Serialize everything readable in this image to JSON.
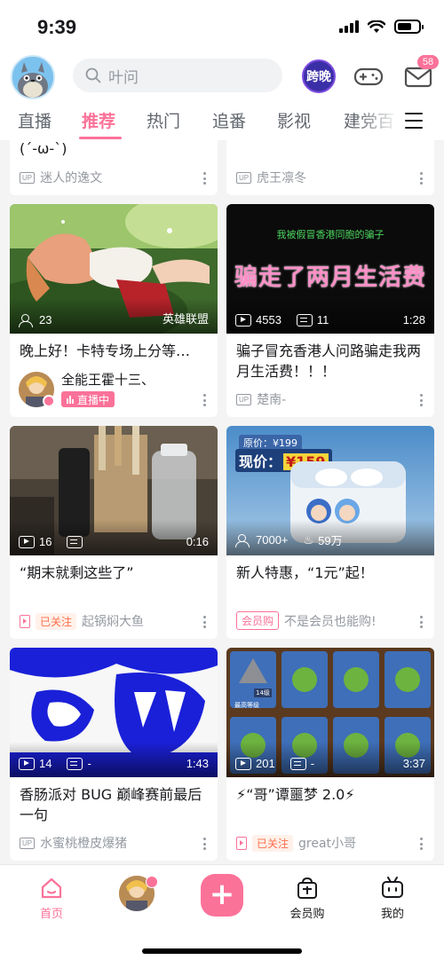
{
  "status_bar": {
    "time": "9:39"
  },
  "header": {
    "search_placeholder": "叶问",
    "event_label": "跨晚",
    "mail_badge": "58"
  },
  "tabs": [
    {
      "label": "直播",
      "active": false
    },
    {
      "label": "推荐",
      "active": true
    },
    {
      "label": "热门",
      "active": false
    },
    {
      "label": "追番",
      "active": false
    },
    {
      "label": "影视",
      "active": false
    },
    {
      "label": "建党百",
      "active": false
    }
  ],
  "feed": {
    "partial_top": [
      {
        "title": "(´-ω-`)",
        "author": "迷人的逸文",
        "tag": "UP"
      },
      {
        "title": "",
        "author": "虎王凛冬",
        "tag": "UP"
      }
    ],
    "cards": [
      {
        "title": "晚上好！卡特专场上分等…",
        "viewers": "23",
        "right_label": "英雄联盟",
        "author": "全能王霍十三、",
        "live_label": "直播中",
        "type": "live"
      },
      {
        "title": "骗子冒充香港人问路骗走我两月生活费！！！",
        "plays": "4553",
        "danmaku": "11",
        "duration": "1:28",
        "author": "楚南-",
        "tag": "UP",
        "cover_top_text": "我被假冒香港同胞的骗子",
        "cover_main_text": "骗走了两月生活费",
        "type": "video"
      },
      {
        "title": "“期末就剩这些了”",
        "plays": "16",
        "danmaku": "",
        "duration": "0:16",
        "author": "起锅焖大鱼",
        "follow_label": "已关注",
        "type": "video-follow"
      },
      {
        "title": "新人特惠，“1元”起！",
        "viewers": "7000+",
        "hot": "59万",
        "author": "不是会员也能购!",
        "vip_label": "会员购",
        "price_original": "原价：¥199",
        "price_now_label": "现价：",
        "price_now": "¥159",
        "type": "ad"
      },
      {
        "title": "香肠派对 BUG 巅峰赛前最后一句",
        "plays": "14",
        "danmaku": "-",
        "duration": "1:43",
        "author": "水蜜桃橙皮爆猪",
        "tag": "UP",
        "type": "video"
      },
      {
        "title": "⚡“哥”谭噩梦 2.0⚡",
        "plays": "201",
        "danmaku": "-",
        "duration": "3:37",
        "author": "great小哥",
        "follow_label": "已关注",
        "card_level": "14级",
        "card_caption": "最高等级",
        "type": "video-follow"
      }
    ]
  },
  "bottom_nav": [
    {
      "label": "首页",
      "active": true
    },
    {
      "label": "",
      "active": false
    },
    {
      "label": "",
      "active": false
    },
    {
      "label": "会员购",
      "active": false
    },
    {
      "label": "我的",
      "active": false
    }
  ],
  "colors": {
    "accent": "#fb7299",
    "follow": "#ff6e4c",
    "muted": "#9499a0"
  }
}
